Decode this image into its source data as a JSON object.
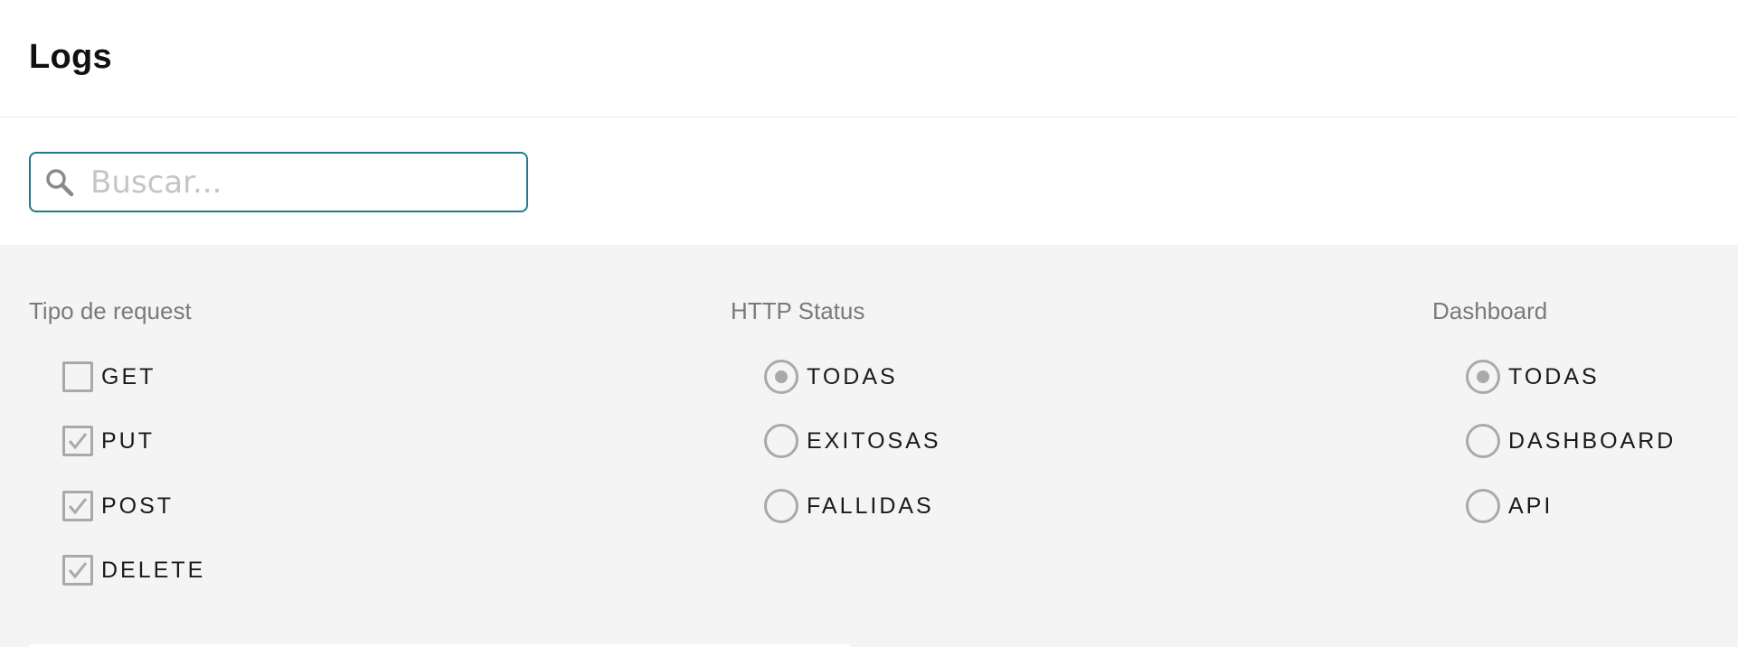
{
  "header": {
    "title": "Logs"
  },
  "search": {
    "placeholder": "Buscar...",
    "value": "",
    "icon": "search-icon"
  },
  "colors": {
    "accent": "#1f7a8c",
    "control": "#a9a9a9",
    "panel_bg": "#f4f4f4"
  },
  "filters": {
    "request_type": {
      "title": "Tipo de request",
      "options": [
        {
          "label": "GET",
          "checked": false
        },
        {
          "label": "PUT",
          "checked": true
        },
        {
          "label": "POST",
          "checked": true
        },
        {
          "label": "DELETE",
          "checked": true
        }
      ]
    },
    "http_status": {
      "title": "HTTP Status",
      "options": [
        {
          "label": "TODAS",
          "selected": true
        },
        {
          "label": "EXITOSAS",
          "selected": false
        },
        {
          "label": "FALLIDAS",
          "selected": false
        }
      ]
    },
    "dashboard": {
      "title": "Dashboard",
      "options": [
        {
          "label": "TODAS",
          "selected": true
        },
        {
          "label": "DASHBOARD",
          "selected": false
        },
        {
          "label": "API",
          "selected": false
        }
      ]
    }
  }
}
